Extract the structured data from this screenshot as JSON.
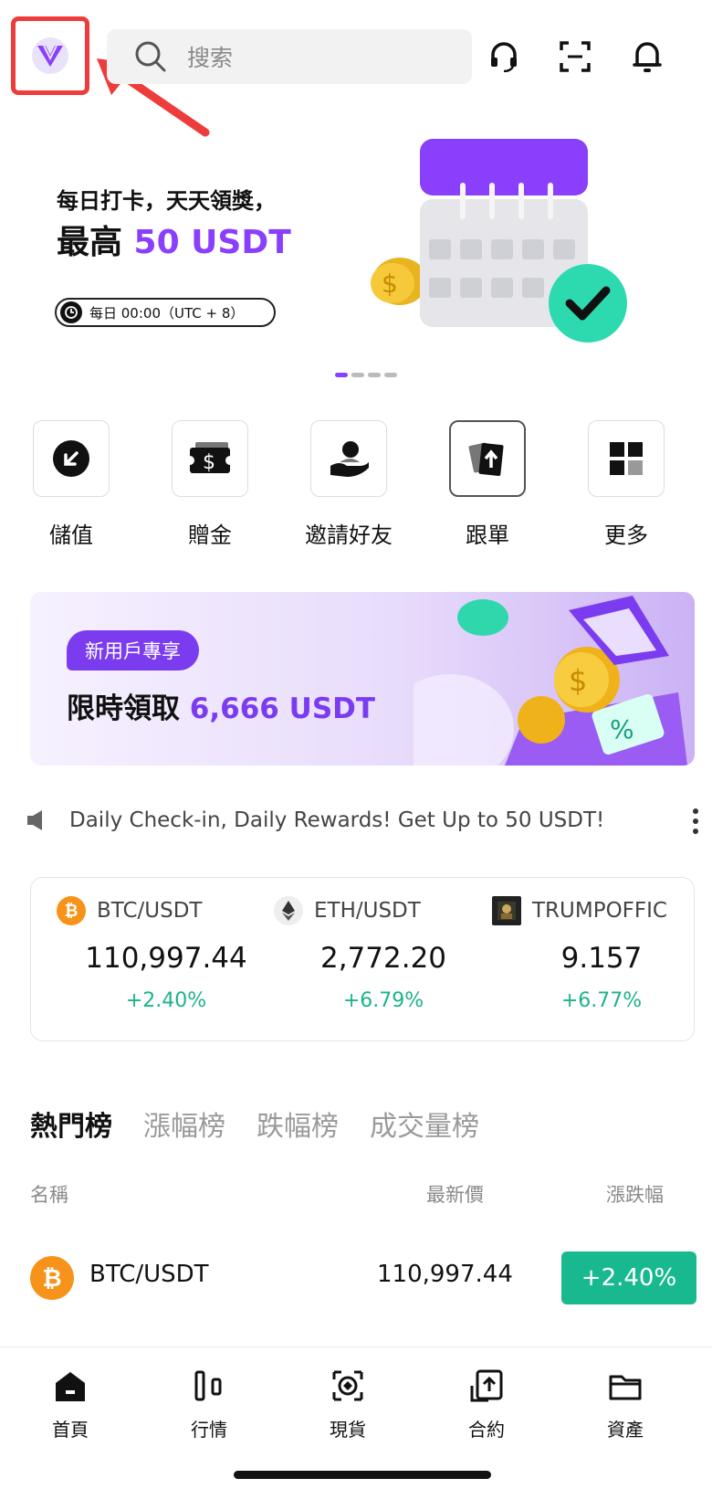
{
  "header": {
    "search_placeholder": "搜索",
    "icons": [
      "headset-icon",
      "scan-icon",
      "bell-icon"
    ]
  },
  "banner": {
    "line1": "每日打卡，天天領獎，",
    "line2_prefix": "最高 ",
    "line2_highlight": "50 USDT",
    "time_pill": "每日 00:00（UTC + 8）"
  },
  "quick_actions": [
    {
      "label": "儲值",
      "icon": "deposit-icon"
    },
    {
      "label": "贈金",
      "icon": "cash-voucher-icon"
    },
    {
      "label": "邀請好友",
      "icon": "invite-friend-icon"
    },
    {
      "label": "跟單",
      "icon": "copy-trade-icon"
    },
    {
      "label": "更多",
      "icon": "grid-more-icon"
    }
  ],
  "promo": {
    "tag": "新用戶專享",
    "text_prefix": "限時領取 ",
    "text_highlight": "6,666 USDT"
  },
  "ticker": {
    "text": "Daily Check-in, Daily Rewards! Get Up to 50 USDT!"
  },
  "markets": [
    {
      "pair": "BTC/USDT",
      "price": "110,997.44",
      "change": "+2.40%"
    },
    {
      "pair": "ETH/USDT",
      "price": "2,772.20",
      "change": "+6.79%"
    },
    {
      "pair": "TRUMPOFFIC",
      "price": "9.157",
      "change": "+6.77%"
    }
  ],
  "tabs": [
    "熱門榜",
    "漲幅榜",
    "跌幅榜",
    "成交量榜"
  ],
  "table_header": {
    "name": "名稱",
    "price": "最新價",
    "change": "漲跌幅"
  },
  "rows": [
    {
      "pair": "BTC/USDT",
      "price": "110,997.44",
      "change": "+2.40%"
    }
  ],
  "nav": [
    {
      "label": "首頁",
      "icon": "home-icon"
    },
    {
      "label": "行情",
      "icon": "market-icon"
    },
    {
      "label": "現貨",
      "icon": "spot-icon"
    },
    {
      "label": "合約",
      "icon": "futures-icon"
    },
    {
      "label": "資產",
      "icon": "wallet-icon"
    }
  ],
  "colors": {
    "accent": "#8a3ffc",
    "up": "#19b98f",
    "highlight_box": "#ee3b3b"
  }
}
